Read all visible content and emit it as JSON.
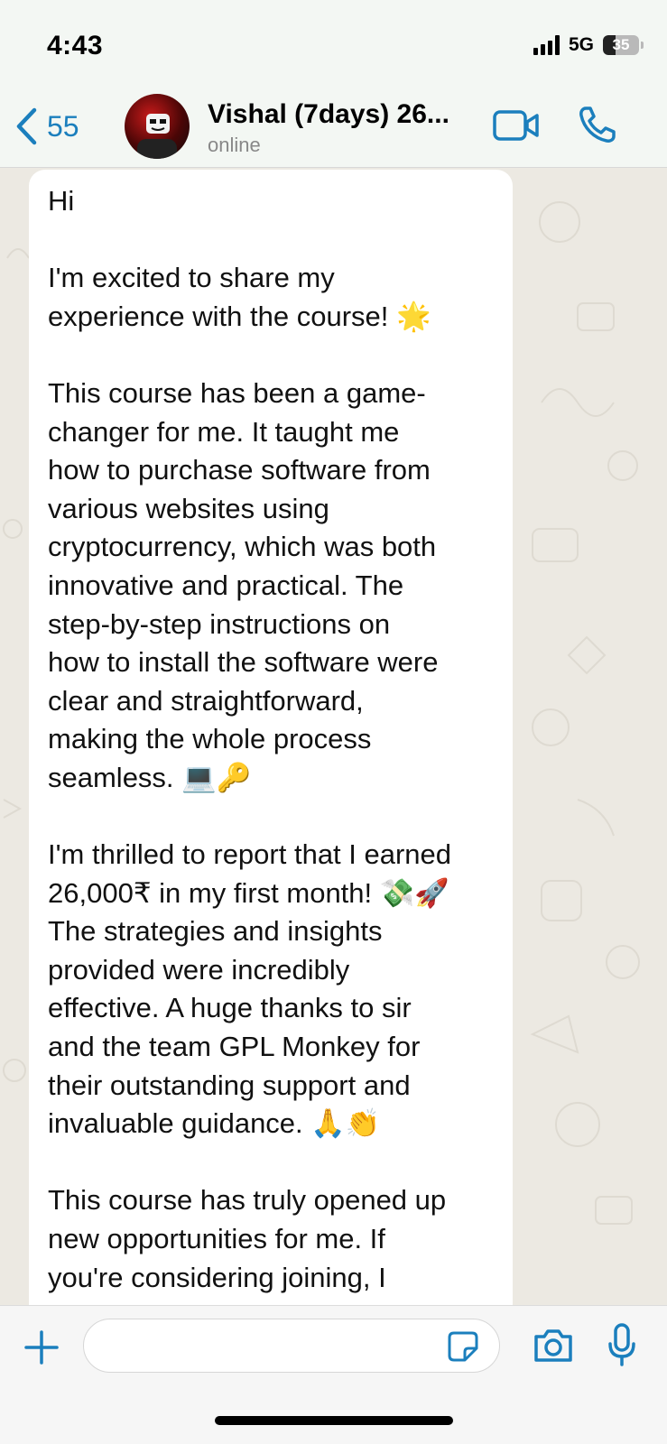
{
  "status_bar": {
    "time": "4:43",
    "network": "5G",
    "battery": "35",
    "battery_level": 0.35
  },
  "header": {
    "back_count": "55",
    "contact_name": "Vishal (7days) 26...",
    "contact_status": "online",
    "accent_color": "#1b7fbd"
  },
  "message": {
    "text": "Hi\n\nI'm excited to share my\nexperience with the course! 🌟\n\nThis course has been a game-\nchanger for me. It taught me\nhow to purchase software from\nvarious websites using\ncryptocurrency, which was both\ninnovative and practical. The\nstep-by-step instructions on\nhow to install the software were\nclear and straightforward,\nmaking the whole process\nseamless. 💻🔑\n\nI'm thrilled to report that I earned\n26,000₹ in my first month! 💸🚀\nThe strategies and insights\nprovided were incredibly\neffective. A huge thanks to sir\nand the team GPL Monkey for\ntheir outstanding support and\ninvaluable guidance. 🙏👏\n\nThis course has truly opened up\nnew opportunities for me. If\nyou're considering joining, I"
  },
  "input_bar": {
    "icons": [
      "plus-icon",
      "sticker-icon",
      "camera-icon",
      "microphone-icon"
    ]
  }
}
